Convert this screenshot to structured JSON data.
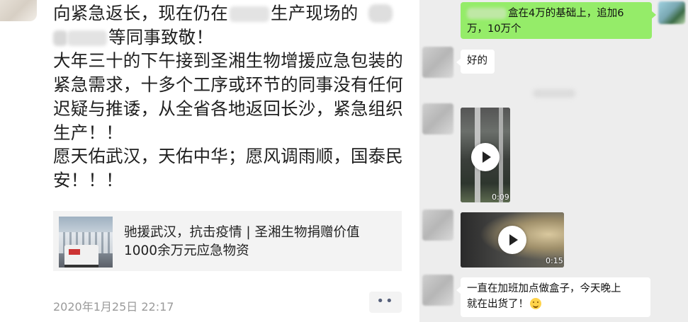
{
  "moment": {
    "lines": {
      "l1a": "向紧急返长，现在仍在",
      "l1b": "生产现场的",
      "l2": "等同事致敬！",
      "p2": "大年三十的下午接到圣湘生物增援应急包装的紧急需求，十多个工序或环节的同事没有任何迟疑与推诿，从全省各地返回长沙，紧急组织生产！！",
      "p3": "愿天佑武汉，天佑中华；愿风调雨顺，国泰民安！！！"
    },
    "link_card": {
      "title_line1": "驰援武汉，抗击疫情 | 圣湘生物捐赠价值",
      "title_line2": "1000余万元应急物资"
    },
    "timestamp": "2020年1月25日 22:17",
    "more_label": "••"
  },
  "chat": {
    "messages": [
      {
        "from": "self",
        "type": "text",
        "text_line1": "盒在4万的基础上，追加6",
        "text_line2": "万，10万个"
      },
      {
        "from": "other",
        "type": "text",
        "text": "好的"
      },
      {
        "from": "other",
        "type": "video",
        "duration": "0:09"
      },
      {
        "from": "other",
        "type": "video",
        "duration": "0:15"
      },
      {
        "from": "other",
        "type": "text",
        "text_line1": "一直在加班加点做盒子，今天晚上",
        "text_line2": "就在出货了！",
        "emoji": "smile-emoji"
      }
    ]
  },
  "colors": {
    "chat_bg": "#ededed",
    "self_bubble": "#95ec69",
    "other_bubble": "#ffffff",
    "card_bg": "#f3f3f3",
    "timestamp": "#9a9a9a"
  }
}
